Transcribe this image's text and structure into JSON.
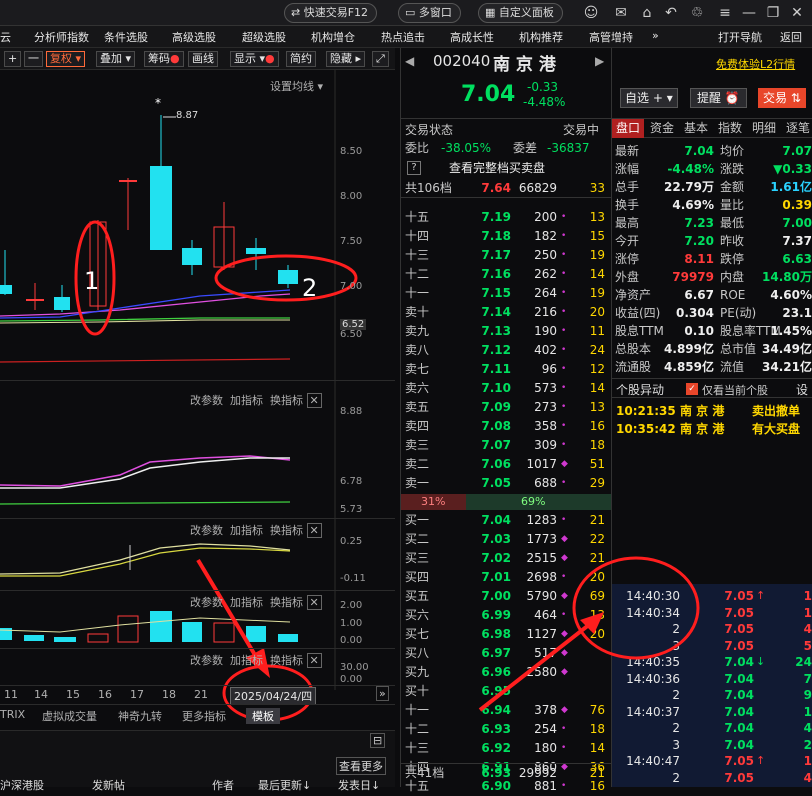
{
  "topbar": {
    "quick_trade": "快速交易F12",
    "multi_window": "多窗口",
    "custom_panel": "自定义面板"
  },
  "menu": [
    "云",
    "分析师指数",
    "条件选股",
    "高级选股",
    "超级选股",
    "机构增仓",
    "热点追击",
    "高成长性",
    "机构推荐",
    "高管增持",
    "»",
    "打开导航",
    "返回"
  ],
  "toolbar": {
    "plus": "+",
    "minus": "一",
    "fuquan": "复权",
    "overlay": "叠加",
    "chips": "筹码",
    "draw": "画线",
    "display": "显示",
    "simple": "简约",
    "hide": "隐藏"
  },
  "chart": {
    "set_ma": "设置均线",
    "peak_label": "8.87",
    "peak_star": "*",
    "price_labels": [
      "8.50",
      "8.00",
      "7.50",
      "7.00",
      "6.52",
      "6.50"
    ],
    "ind_labels_1": [
      "8.88",
      "6.78",
      "5.73"
    ],
    "ind_labels_2": [
      "0.25",
      "-0.11"
    ],
    "ind_labels_3": [
      "2.00",
      "1.00",
      "0.00"
    ],
    "ind_labels_4": [
      "30.00",
      "0.00"
    ],
    "ind_controls": [
      "改参数",
      "加指标",
      "换指标"
    ],
    "close_x": "✕",
    "annot1": "1",
    "annot2": "2",
    "dates": [
      "11",
      "14",
      "15",
      "16",
      "17",
      "18",
      "21"
    ],
    "date_box": "2025/04/24/四",
    "bottom_tabs": [
      "TRIX",
      "虚拟成交量",
      "神奇九转",
      "更多指标"
    ],
    "bottom_tab_active": "模板",
    "check_more": "查看更多",
    "status": [
      "沪深港股",
      "发新帖",
      "作者",
      "最后更新↓",
      "发表日↓"
    ]
  },
  "quote": {
    "code": "002040",
    "name": "南 京 港",
    "price": "7.04",
    "change": "-0.33",
    "pct": "-4.48%",
    "free_l2": "免费体验L2行情",
    "zixuan": "自选",
    "zixuan_plus": "+",
    "tixing": "提醒",
    "jiaoyi": "交易"
  },
  "ob_header": {
    "title": "交易状态",
    "tab": "交易中",
    "weibi_k": "委比",
    "weibi_v": "-38.05%",
    "weicha_k": "委差",
    "weicha_v": "-36837",
    "btn": "?",
    "btn_label": "查看完整档买卖盘",
    "total_k": "共106档",
    "total_p": "7.64",
    "total_vol": "66829",
    "total_cnt": "33"
  },
  "asks": [
    {
      "lb": "十五",
      "p": "7.19",
      "v": "200",
      "c": "13",
      "d": "•"
    },
    {
      "lb": "十四",
      "p": "7.18",
      "v": "182",
      "c": "15",
      "d": "•"
    },
    {
      "lb": "十三",
      "p": "7.17",
      "v": "250",
      "c": "19",
      "d": "•"
    },
    {
      "lb": "十二",
      "p": "7.16",
      "v": "262",
      "c": "14",
      "d": "•"
    },
    {
      "lb": "十一",
      "p": "7.15",
      "v": "264",
      "c": "19",
      "d": "•"
    },
    {
      "lb": "卖十",
      "p": "7.14",
      "v": "216",
      "c": "20",
      "d": "•"
    },
    {
      "lb": "卖九",
      "p": "7.13",
      "v": "190",
      "c": "11",
      "d": "•"
    },
    {
      "lb": "卖八",
      "p": "7.12",
      "v": "402",
      "c": "24",
      "d": "•"
    },
    {
      "lb": "卖七",
      "p": "7.11",
      "v": "96",
      "c": "12",
      "d": "•"
    },
    {
      "lb": "卖六",
      "p": "7.10",
      "v": "573",
      "c": "14",
      "d": "•"
    },
    {
      "lb": "卖五",
      "p": "7.09",
      "v": "273",
      "c": "13",
      "d": "•"
    },
    {
      "lb": "卖四",
      "p": "7.08",
      "v": "358",
      "c": "16",
      "d": "•"
    },
    {
      "lb": "卖三",
      "p": "7.07",
      "v": "309",
      "c": "18",
      "d": "•"
    },
    {
      "lb": "卖二",
      "p": "7.06",
      "v": "1017",
      "c": "51",
      "d": "◆"
    },
    {
      "lb": "卖一",
      "p": "7.05",
      "v": "688",
      "c": "29",
      "d": "•"
    }
  ],
  "ratio": {
    "left": "31%",
    "right": "69%"
  },
  "bids": [
    {
      "lb": "买一",
      "p": "7.04",
      "v": "1283",
      "c": "21",
      "d": "•"
    },
    {
      "lb": "买二",
      "p": "7.03",
      "v": "1773",
      "c": "22",
      "d": "◆"
    },
    {
      "lb": "买三",
      "p": "7.02",
      "v": "2515",
      "c": "21",
      "d": "◆"
    },
    {
      "lb": "买四",
      "p": "7.01",
      "v": "2698",
      "c": "20",
      "d": "•"
    },
    {
      "lb": "买五",
      "p": "7.00",
      "v": "5790",
      "c": "69",
      "d": "◆"
    },
    {
      "lb": "买六",
      "p": "6.99",
      "v": "464",
      "c": "13",
      "d": "•"
    },
    {
      "lb": "买七",
      "p": "6.98",
      "v": "1127",
      "c": "20",
      "d": "◆"
    },
    {
      "lb": "买八",
      "p": "6.97",
      "v": "517",
      "c": "",
      "d": "◆"
    },
    {
      "lb": "买九",
      "p": "6.96",
      "v": "2580",
      "c": "",
      "d": "◆"
    },
    {
      "lb": "买十",
      "p": "6.95",
      "v": "",
      "c": "",
      "d": ""
    },
    {
      "lb": "十一",
      "p": "6.94",
      "v": "378",
      "c": "76",
      "d": "◆"
    },
    {
      "lb": "十二",
      "p": "6.93",
      "v": "254",
      "c": "18",
      "d": "•"
    },
    {
      "lb": "十三",
      "p": "6.92",
      "v": "180",
      "c": "14",
      "d": "•"
    },
    {
      "lb": "十四",
      "p": "6.91",
      "v": "860",
      "c": "36",
      "d": "◆"
    },
    {
      "lb": "十五",
      "p": "6.90",
      "v": "881",
      "c": "16",
      "d": "•"
    }
  ],
  "ob_footer": {
    "k": "共41档",
    "p": "6.93",
    "v": "29992",
    "c": "21"
  },
  "ftabs": [
    "盘口",
    "资金",
    "基本",
    "指数",
    "明细",
    "逐笔"
  ],
  "fund": [
    {
      "k1": "最新",
      "v1": "7.04",
      "c1": "green",
      "k2": "均价",
      "v2": "7.07",
      "c2": "green"
    },
    {
      "k1": "涨幅",
      "v1": "-4.48%",
      "c1": "green",
      "k2": "涨跌",
      "v2": "▼0.33",
      "c2": "green"
    },
    {
      "k1": "总手",
      "v1": "22.79万",
      "c1": "white",
      "k2": "金额",
      "v2": "1.61亿",
      "c2": "cyan"
    },
    {
      "k1": "换手",
      "v1": "4.69%",
      "c1": "white",
      "k2": "量比",
      "v2": "0.39",
      "c2": "yellow"
    },
    {
      "k1": "最高",
      "v1": "7.23",
      "c1": "green",
      "k2": "最低",
      "v2": "7.00",
      "c2": "green"
    },
    {
      "k1": "今开",
      "v1": "7.20",
      "c1": "green",
      "k2": "昨收",
      "v2": "7.37",
      "c2": "white"
    },
    {
      "k1": "涨停",
      "v1": "8.11",
      "c1": "red",
      "k2": "跌停",
      "v2": "6.63",
      "c2": "green"
    },
    {
      "k1": "外盘",
      "v1": "79979",
      "c1": "red",
      "k2": "内盘",
      "v2": "14.80万",
      "c2": "green"
    },
    {
      "k1": "净资产",
      "v1": "6.67",
      "c1": "white",
      "k2": "ROE",
      "v2": "4.60%",
      "c2": "white"
    },
    {
      "k1": "收益(四)",
      "v1": "0.304",
      "c1": "white",
      "k2": "PE(动)",
      "v2": "23.1",
      "c2": "white"
    },
    {
      "k1": "股息TTM",
      "v1": "0.10",
      "c1": "white",
      "k2": "股息率TTM",
      "v2": "1.45%",
      "c2": "white"
    },
    {
      "k1": "总股本",
      "v1": "4.899亿",
      "c1": "white",
      "k2": "总市值",
      "v2": "34.49亿",
      "c2": "white"
    },
    {
      "k1": "流通股",
      "v1": "4.859亿",
      "c1": "white",
      "k2": "流值",
      "v2": "34.21亿",
      "c2": "white"
    }
  ],
  "movers": {
    "title": "个股异动",
    "check_label": "仅看当前个股",
    "settings": "设",
    "rows": [
      {
        "t": "10:21:35",
        "n": "南 京 港",
        "e": "卖出撤单"
      },
      {
        "t": "10:35:42",
        "n": "南 京 港",
        "e": "有大买盘"
      }
    ]
  },
  "trades": [
    {
      "t": "14:40:30",
      "p": "7.05",
      "ar": "↑",
      "v": "1",
      "c": "red"
    },
    {
      "t": "14:40:34",
      "p": "7.05",
      "ar": "",
      "v": "1",
      "c": "red"
    },
    {
      "t": "2",
      "p": "7.05",
      "ar": "",
      "v": "4",
      "c": "red"
    },
    {
      "t": "3",
      "p": "7.05",
      "ar": "",
      "v": "5",
      "c": "red"
    },
    {
      "t": "14:40:35",
      "p": "7.04",
      "ar": "↓",
      "v": "24",
      "c": "green"
    },
    {
      "t": "14:40:36",
      "p": "7.04",
      "ar": "",
      "v": "7",
      "c": "green"
    },
    {
      "t": "2",
      "p": "7.04",
      "ar": "",
      "v": "9",
      "c": "green"
    },
    {
      "t": "14:40:37",
      "p": "7.04",
      "ar": "",
      "v": "1",
      "c": "green"
    },
    {
      "t": "2",
      "p": "7.04",
      "ar": "",
      "v": "4",
      "c": "green"
    },
    {
      "t": "3",
      "p": "7.04",
      "ar": "",
      "v": "2",
      "c": "green"
    },
    {
      "t": "14:40:47",
      "p": "7.05",
      "ar": "↑",
      "v": "1",
      "c": "red"
    },
    {
      "t": "2",
      "p": "7.05",
      "ar": "",
      "v": "4",
      "c": "red"
    }
  ],
  "colors": {
    "up": "#ff3a3a",
    "down": "#00e060",
    "candle_cyan": "#22e1f0",
    "annot": "#ff1e1e",
    "highlight": "#ffd700"
  }
}
